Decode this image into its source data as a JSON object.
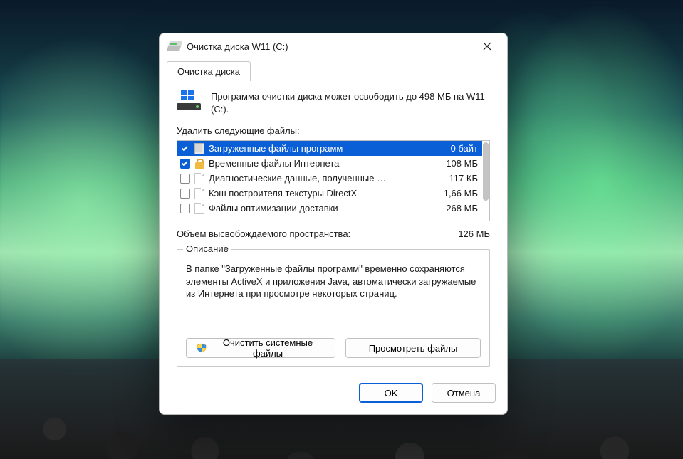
{
  "window": {
    "title": "Очистка диска W11 (C:)"
  },
  "tabs": {
    "main": "Очистка диска"
  },
  "summary": "Программа очистки диска может освободить до 498 МБ на W11 (C:).",
  "list_label": "Удалить следующие файлы:",
  "files": [
    {
      "checked": true,
      "selected": true,
      "icon": "stack",
      "name": "Загруженные файлы программ",
      "size": "0 байт"
    },
    {
      "checked": true,
      "selected": false,
      "icon": "lock",
      "name": "Временные файлы Интернета",
      "size": "108 МБ"
    },
    {
      "checked": false,
      "selected": false,
      "icon": "page",
      "name": "Диагностические данные, полученные …",
      "size": "117 КБ"
    },
    {
      "checked": false,
      "selected": false,
      "icon": "page",
      "name": "Кэш построителя текстуры DirectX",
      "size": "1,66 МБ"
    },
    {
      "checked": false,
      "selected": false,
      "icon": "page",
      "name": "Файлы оптимизации доставки",
      "size": "268 МБ"
    }
  ],
  "freed": {
    "label": "Объем высвобождаемого пространства:",
    "value": "126 МБ"
  },
  "description": {
    "legend": "Описание",
    "text": "В папке \"Загруженные файлы программ\" временно сохраняются элементы ActiveX и приложения Java, автоматически загружаемые из Интернета при просмотре некоторых страниц."
  },
  "buttons": {
    "clean_system": "Очистить системные файлы",
    "view_files": "Просмотреть файлы",
    "ok": "OK",
    "cancel": "Отмена"
  }
}
